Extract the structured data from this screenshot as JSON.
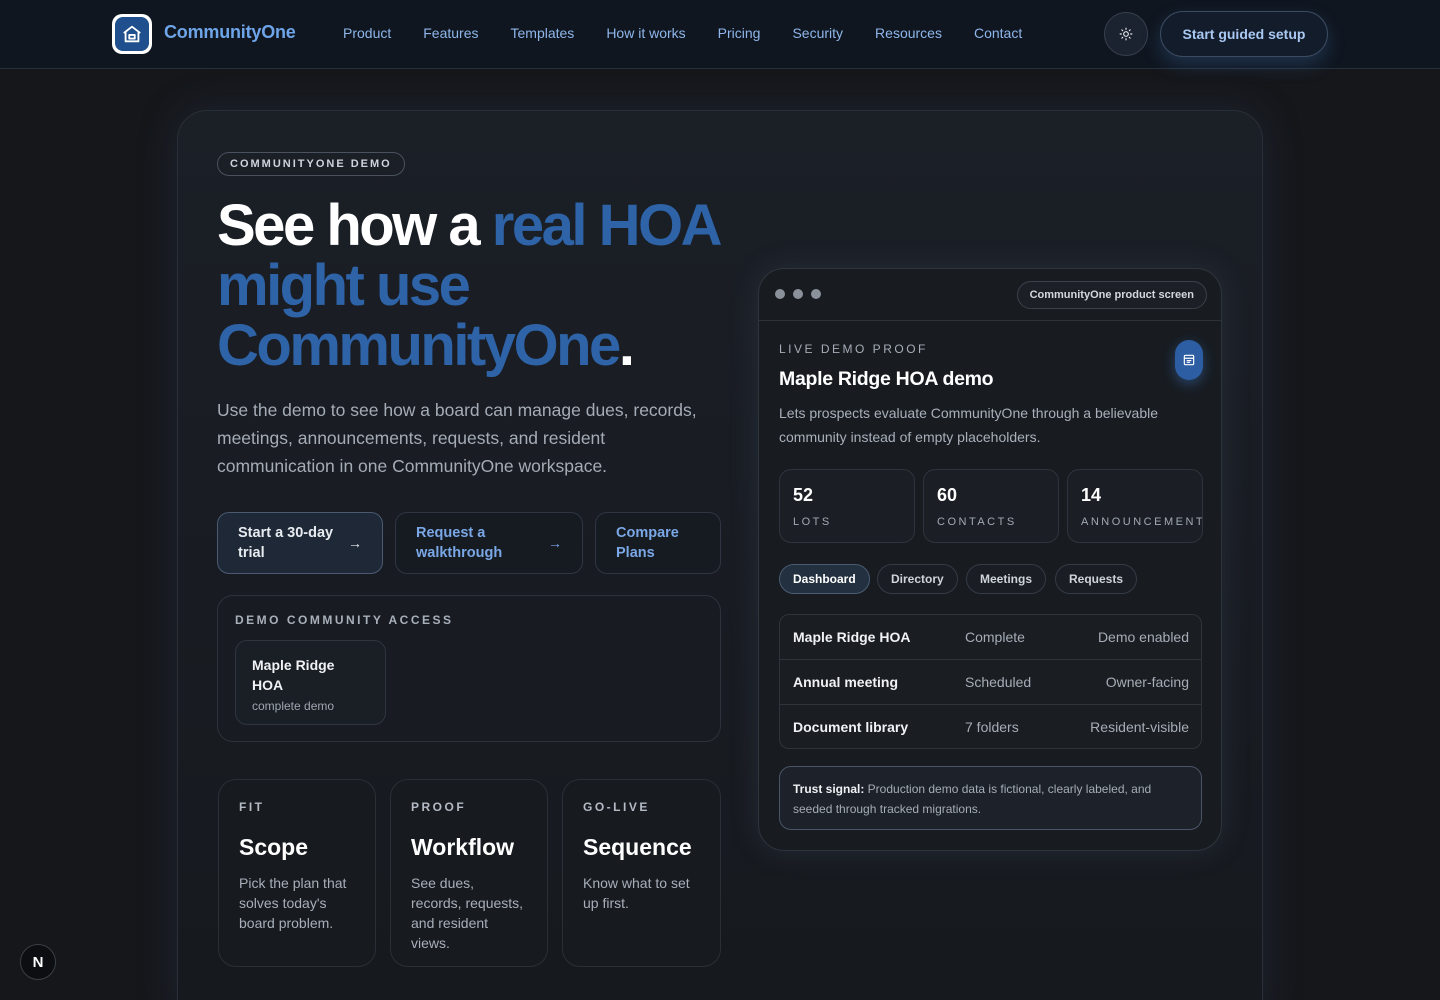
{
  "nav": {
    "brand": "CommunityOne",
    "links": [
      "Product",
      "Features",
      "Templates",
      "How it works",
      "Pricing",
      "Security",
      "Resources",
      "Contact"
    ],
    "setup_label": "Start guided setup"
  },
  "hero": {
    "tag": "COMMUNITYONE DEMO",
    "headline_plain": "See how a ",
    "headline_accent": "real HOA might use CommunityOne",
    "headline_end": ".",
    "subtext": "Use the demo to see how a board can manage dues, records, meetings, announcements, requests, and resident communication in one CommunityOne workspace.",
    "cta_trial": "Start a 30-day trial",
    "cta_walkthrough": "Request a walkthrough",
    "cta_compare": "Compare Plans"
  },
  "access": {
    "title": "DEMO COMMUNITY ACCESS",
    "item_name": "Maple Ridge HOA",
    "item_sub": "complete demo"
  },
  "cards": [
    {
      "tag": "FIT",
      "title": "Scope",
      "desc": "Pick the plan that solves today's board problem."
    },
    {
      "tag": "PROOF",
      "title": "Workflow",
      "desc": "See dues, records, requests, and resident views."
    },
    {
      "tag": "GO-LIVE",
      "title": "Sequence",
      "desc": "Know what to set up first."
    }
  ],
  "screen": {
    "pill": "CommunityOne product screen",
    "live_tag": "LIVE DEMO PROOF",
    "title": "Maple Ridge HOA demo",
    "desc": "Lets prospects evaluate CommunityOne through a believable community instead of empty placeholders.",
    "stats": [
      {
        "num": "52",
        "label": "LOTS"
      },
      {
        "num": "60",
        "label": "CONTACTS"
      },
      {
        "num": "14",
        "label": "ANNOUNCEMENTS"
      }
    ],
    "tabs": [
      "Dashboard",
      "Directory",
      "Meetings",
      "Requests"
    ],
    "rows": [
      {
        "name": "Maple Ridge HOA",
        "status": "Complete",
        "note": "Demo enabled"
      },
      {
        "name": "Annual meeting",
        "status": "Scheduled",
        "note": "Owner-facing"
      },
      {
        "name": "Document library",
        "status": "7 folders",
        "note": "Resident-visible"
      }
    ],
    "trust_label": "Trust signal:",
    "trust_text": " Production demo data is fictional, clearly labeled, and seeded through tracked migrations."
  },
  "badge": "N"
}
